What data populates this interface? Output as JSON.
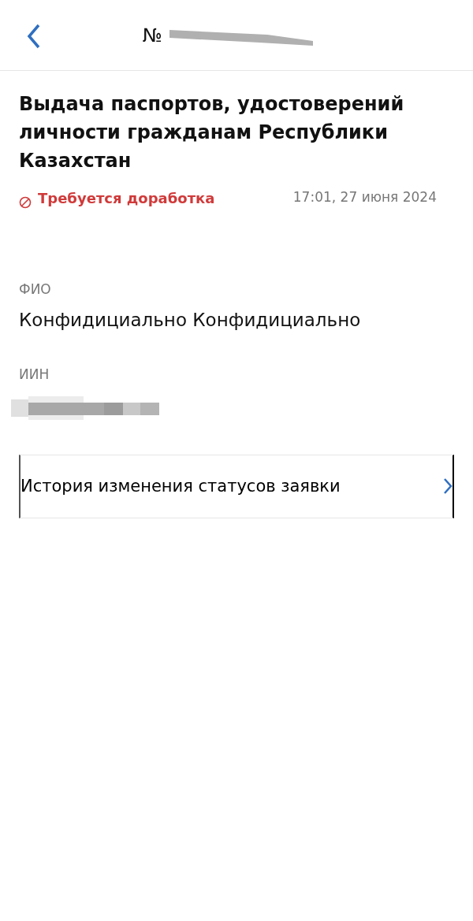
{
  "header": {
    "title": "№"
  },
  "request": {
    "title": "Выдача паспортов, удостоверений личности гражданам Республики Казахстан",
    "status": {
      "kind": "rework",
      "text": "Требуется доработка"
    },
    "datetime": "17:01, 27 июня 2024"
  },
  "fields": [
    {
      "label": "ФИО",
      "value": "Конфидициально Конфидициально"
    },
    {
      "label": "ИИН",
      "kind": "redacted"
    }
  ],
  "links": [
    {
      "label": "История изменения статусов заявки"
    }
  ]
}
